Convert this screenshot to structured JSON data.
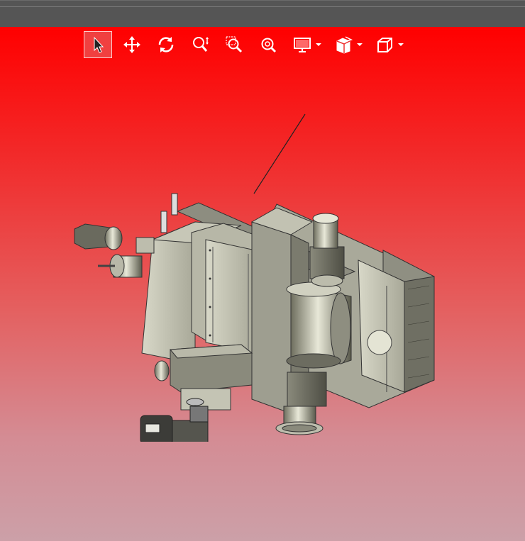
{
  "window": {
    "titlebar_color": "#555555"
  },
  "viewport": {
    "background_top": "#ff0000",
    "background_bottom": "#cca0a8",
    "model": {
      "description_icon": "cnc-machine-assembly-3d-model"
    }
  },
  "toolbar": {
    "tools": [
      {
        "icon": "select-arrow-icon",
        "active": true
      },
      {
        "icon": "pan-move-icon",
        "active": false
      },
      {
        "icon": "rotate-icon",
        "active": false
      },
      {
        "icon": "zoom-dynamic-icon",
        "active": false
      },
      {
        "icon": "zoom-window-icon",
        "active": false
      },
      {
        "icon": "zoom-fit-icon",
        "active": false
      },
      {
        "icon": "display-mode-icon",
        "active": false,
        "dropdown": true
      },
      {
        "icon": "section-view-icon",
        "active": false,
        "dropdown": true
      },
      {
        "icon": "view-cube-icon",
        "active": false,
        "dropdown": true
      }
    ]
  }
}
